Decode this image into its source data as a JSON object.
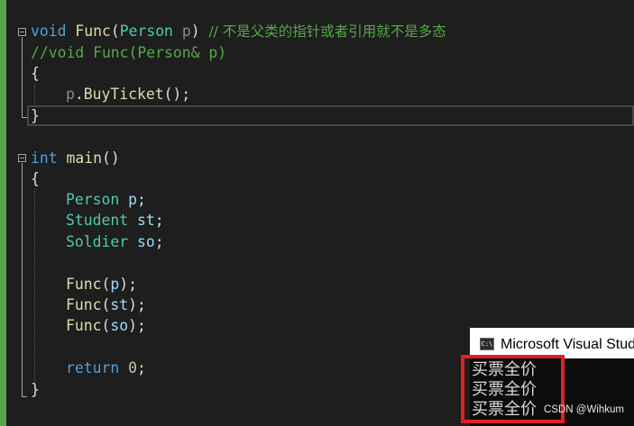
{
  "editor": {
    "lines": {
      "func_sig": {
        "kw": "void",
        "fn": "Func",
        "open": "(",
        "type": "Person",
        "param": "p",
        "close": ")",
        "comment": "// 不是父类的指针或者引用就不是多态"
      },
      "func_alt_comment": "//void Func(Person& p)",
      "brace_open_1": "{",
      "call_line": {
        "obj": "p",
        "dot": ".",
        "method": "BuyTicket",
        "rest": "();"
      },
      "brace_close_1": "}",
      "main_sig": {
        "kw": "int",
        "fn": "main",
        "parens": "()"
      },
      "brace_open_2": "{",
      "decls": [
        {
          "type": "Person",
          "var": "p"
        },
        {
          "type": "Student",
          "var": "st"
        },
        {
          "type": "Soldier",
          "var": "so"
        }
      ],
      "calls": [
        {
          "fn": "Func",
          "arg": "p"
        },
        {
          "fn": "Func",
          "arg": "st"
        },
        {
          "fn": "Func",
          "arg": "so"
        }
      ],
      "return_stmt": {
        "kw": "return",
        "value": "0",
        "semi": ";"
      },
      "brace_close_2": "}"
    }
  },
  "console": {
    "title": "Microsoft Visual Studio",
    "icon_label": "C:\\",
    "output": [
      "买票全价",
      "买票全价",
      "买票全价"
    ]
  },
  "watermark": "CSDN @Wihkum",
  "colors": {
    "background": "#1e1e1e",
    "keyword": "#569cd6",
    "function": "#dcdcaa",
    "type": "#4ec9b0",
    "variable": "#9cdcfe",
    "comment": "#57a64a",
    "number": "#b5cea8",
    "highlight_box": "#e02020"
  },
  "icons": [
    "fold-collapse-icon",
    "console-app-icon"
  ]
}
